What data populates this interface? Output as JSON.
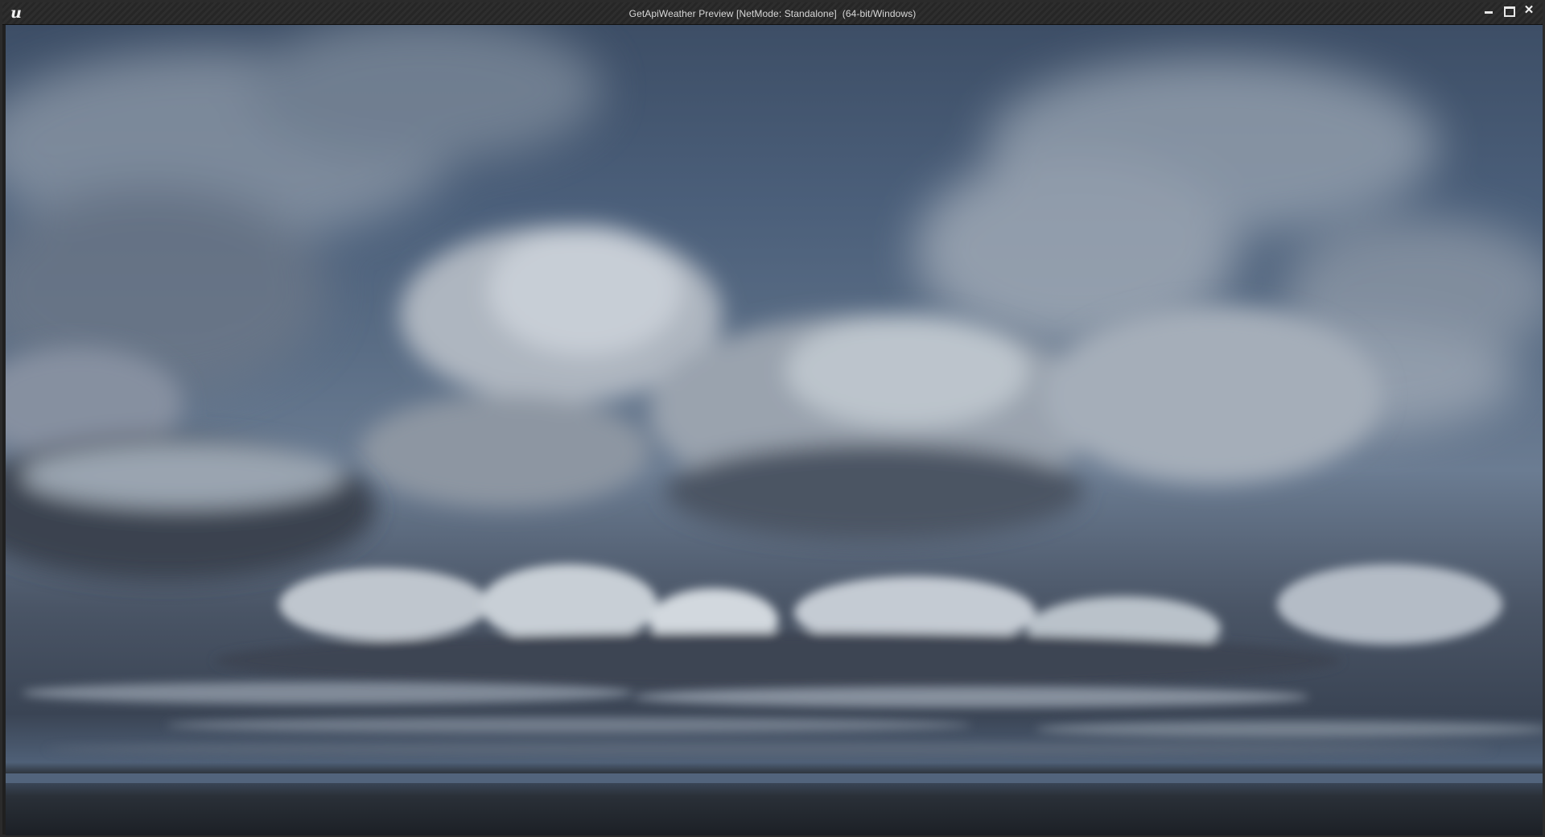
{
  "window": {
    "title": "GetApiWeather Preview [NetMode: Standalone]  (64-bit/Windows)",
    "logo_glyph": "u",
    "controls": {
      "minimize_icon": "minimize-icon",
      "maximize_icon": "maximize-icon",
      "close_icon": "close-icon",
      "close_glyph": "✕"
    }
  },
  "viewport": {
    "scene": "sky-clouds-ocean",
    "colors": {
      "sky_top": "#3d4e66",
      "sky_mid": "#6b7c92",
      "cloud_light": "#c9d0d8",
      "cloud_shadow": "#3e4654",
      "horizon": "#52647c",
      "ocean": "#23282f"
    }
  }
}
